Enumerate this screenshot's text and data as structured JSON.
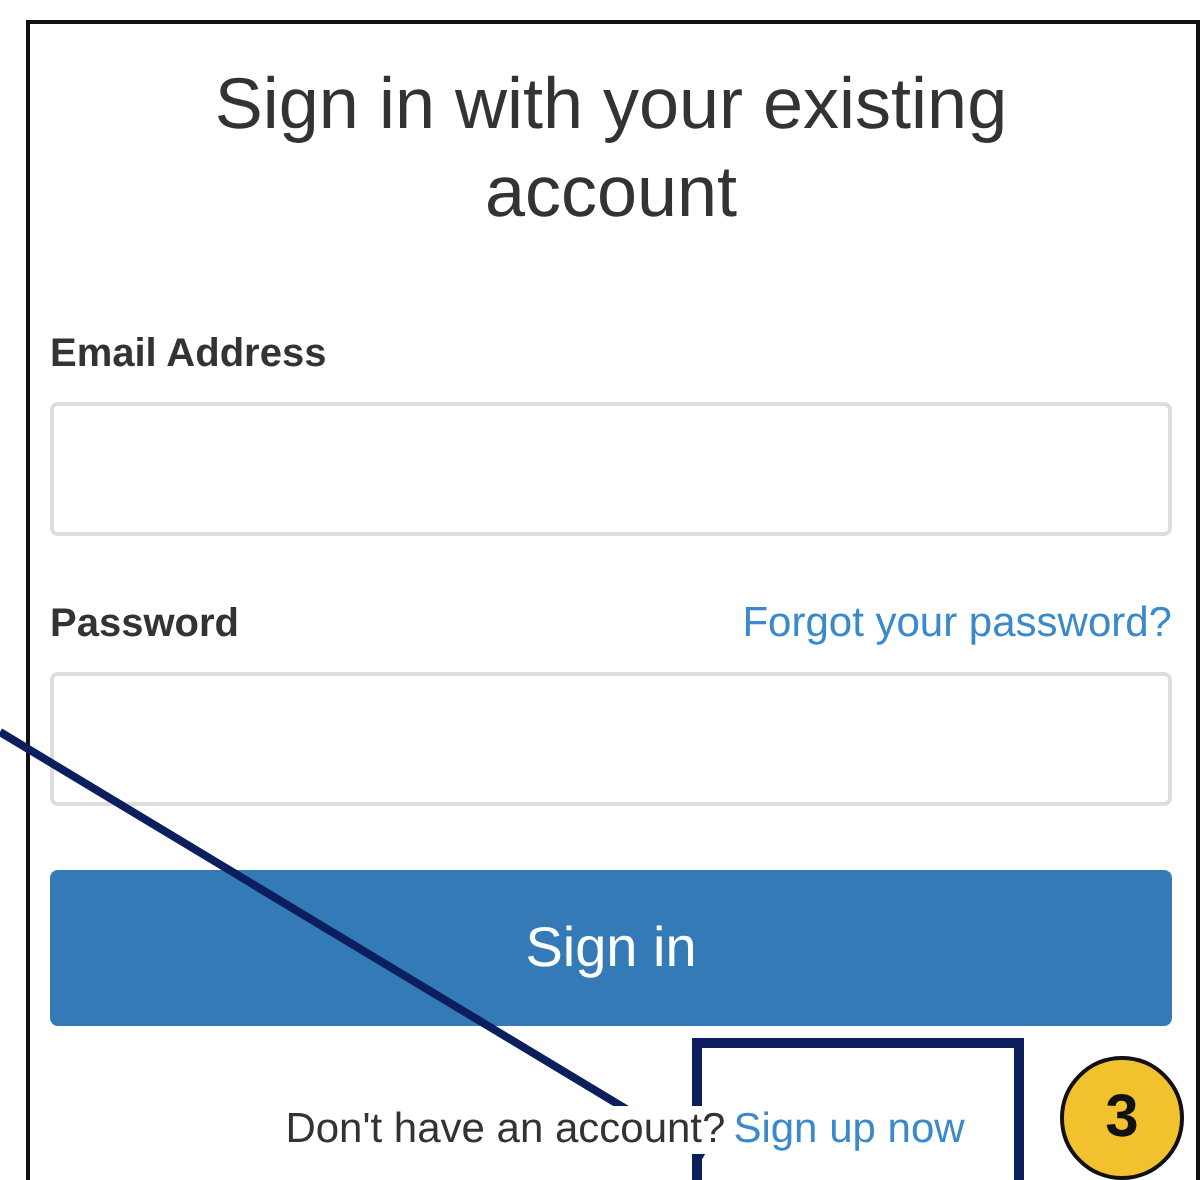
{
  "heading": "Sign in with your existing account",
  "fields": [
    {
      "label": "Email Address"
    },
    {
      "label": "Password",
      "link": "Forgot your password?"
    }
  ],
  "submit": "Sign in",
  "footer": {
    "prompt": "Don't have an account?",
    "link": "Sign up now"
  },
  "annotation": {
    "badge": "3"
  }
}
